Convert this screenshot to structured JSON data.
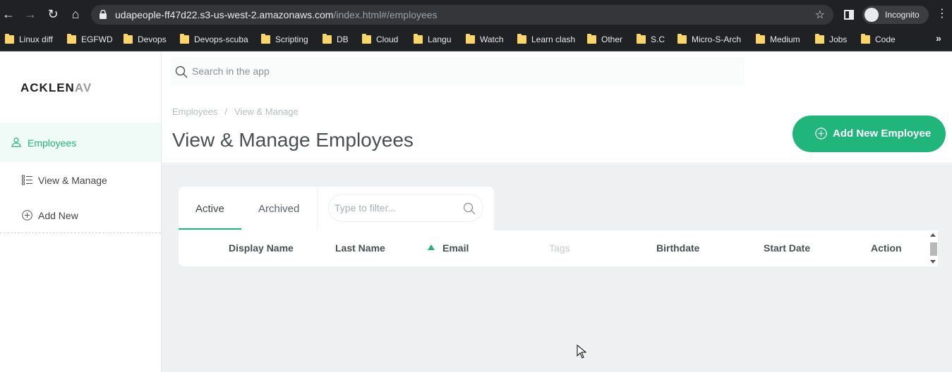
{
  "browser": {
    "url_host": "udapeople-ff47d22.s3-us-west-2.amazonaws.com",
    "url_path": "/index.html#/employees",
    "incognito_label": "Incognito",
    "bookmarks": [
      "Linux diff",
      "EGFWD",
      "Devops",
      "Devops-scuba",
      "Scripting",
      "DB",
      "Cloud",
      "Langu",
      "Watch",
      "Learn clash",
      "Other",
      "S.C",
      "Micro-S-Arch",
      "Medium",
      "Jobs",
      "Code"
    ],
    "more_label": "»"
  },
  "sidebar": {
    "logo_main": "ACKLEN",
    "logo_fade": "AV",
    "employees_label": "Employees",
    "view_manage_label": "View & Manage",
    "add_new_label": "Add New"
  },
  "topbar": {
    "search_placeholder": "Search in the app",
    "breadcrumb_root": "Employees",
    "breadcrumb_sep": "/",
    "breadcrumb_current": "View & Manage",
    "title": "View & Manage Employees",
    "add_button_label": "Add New Employee"
  },
  "content": {
    "tab_active": "Active",
    "tab_archived": "Archived",
    "filter_placeholder": "Type to filter...",
    "columns": [
      "Display Name",
      "Last Name",
      "Email",
      "Tags",
      "Birthdate",
      "Start Date",
      "Action"
    ],
    "sorted_column": "Email",
    "sort_direction": "ascending"
  },
  "colors": {
    "accent": "#1fb57b",
    "background": "#eef0f1"
  }
}
